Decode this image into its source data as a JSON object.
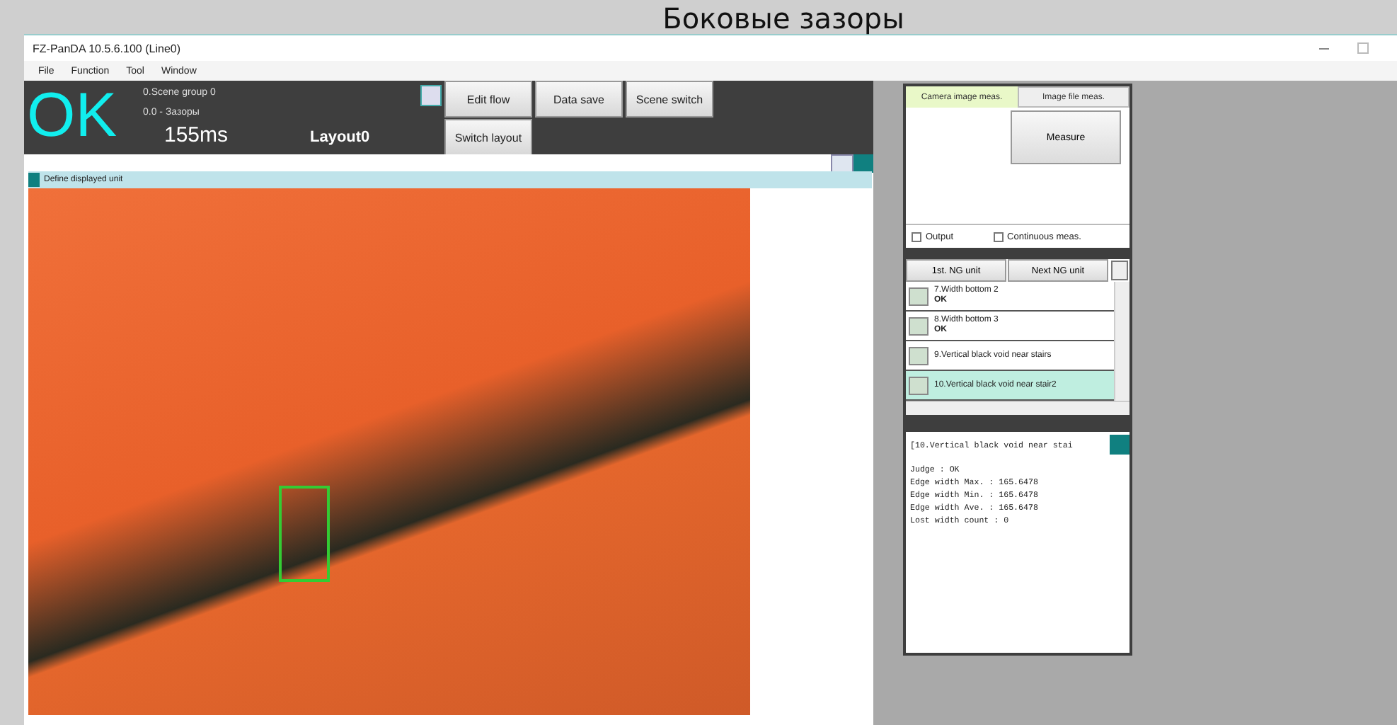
{
  "slide_title": "Боковые зазоры",
  "window": {
    "title": "FZ-PanDA 10.5.6.100 (Line0)"
  },
  "menu": [
    "File",
    "Function",
    "Tool",
    "Window"
  ],
  "status": {
    "judge": "OK",
    "scene_group": "0.Scene group 0",
    "scene": "0.0 - Зазоры",
    "time": "155ms",
    "layout": "Layout0"
  },
  "toolbar_buttons": [
    {
      "label": "Edit flow"
    },
    {
      "label": "Data save"
    },
    {
      "label": "Scene switch"
    },
    {
      "label": "Switch layout"
    }
  ],
  "image_panel": {
    "header": "Define displayed unit"
  },
  "measure_panel": {
    "tabs": [
      {
        "label": "Camera image meas.",
        "selected": true
      },
      {
        "label": "Image file meas.",
        "selected": false
      }
    ],
    "measure_button": "Measure",
    "options": [
      {
        "label": "Output",
        "checked": false
      },
      {
        "label": "Continuous meas.",
        "checked": false
      }
    ]
  },
  "ng_buttons": [
    "1st. NG unit",
    "Next NG unit"
  ],
  "units": [
    {
      "name": "7.Width bottom 2",
      "judge": "OK",
      "selected": false
    },
    {
      "name": "8.Width bottom 3",
      "judge": "OK",
      "selected": false
    },
    {
      "name": "9.Vertical black void near stairs",
      "selected": false
    },
    {
      "name": "10.Vertical black void near stair2",
      "selected": true
    }
  ],
  "result_text": {
    "header": "[10.Vertical black void near stai",
    "lines": [
      "Judge : OK",
      "Edge width Max. : 165.6478",
      "Edge width Min. : 165.6478",
      "Edge width Ave. : 165.6478",
      "Lost width count : 0"
    ]
  }
}
